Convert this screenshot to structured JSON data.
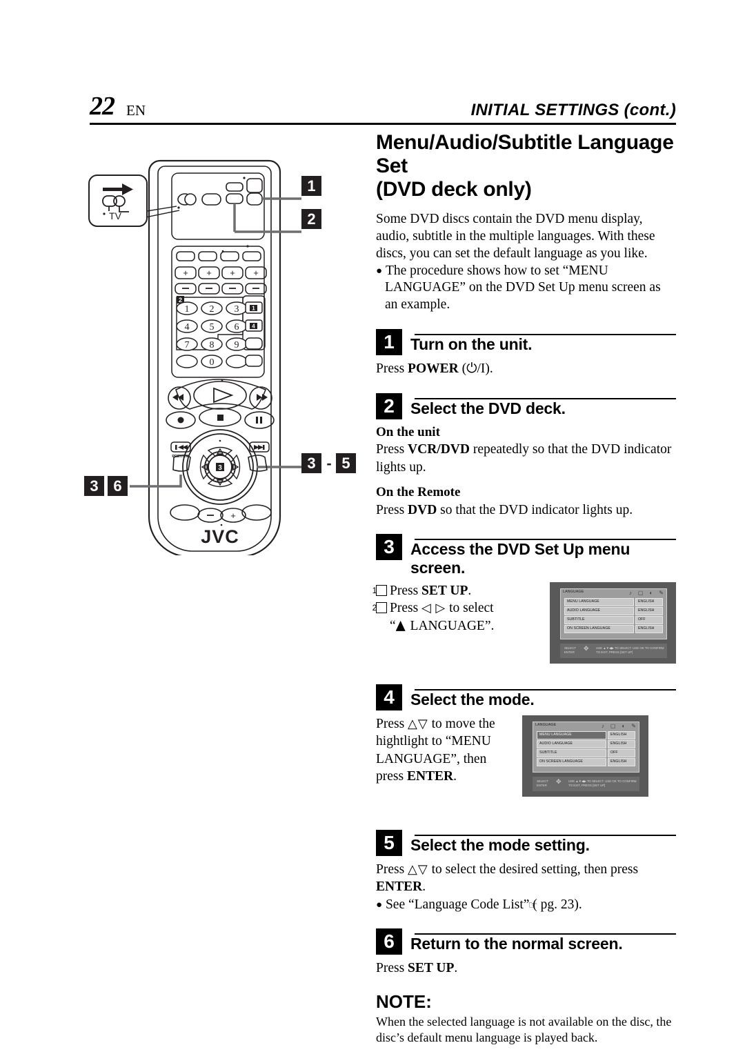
{
  "header": {
    "page_number": "22",
    "lang_code": "EN",
    "section_title": "INITIAL SETTINGS (cont.)"
  },
  "doc": {
    "title_line1": "Menu/Audio/Subtitle Language Set",
    "title_line2": "(DVD deck only)",
    "intro": "Some DVD discs contain the DVD menu display, audio, subtitle in the multiple languages. With these discs, you can set the default language as you like.",
    "intro_bullet_1": "The procedure shows how to set “MENU LANGUAGE” on the DVD Set Up menu screen as an example."
  },
  "steps": [
    {
      "num": "1",
      "title": "Turn on the unit.",
      "body_pre": "Press ",
      "body_bold": "POWER",
      "body_post": " (⏻/I)."
    },
    {
      "num": "2",
      "title": "Select the DVD deck.",
      "unit_heading": "On the unit",
      "unit_pre": "Press ",
      "unit_bold": "VCR/DVD",
      "unit_post": " repeatedly so that the DVD indicator lights up.",
      "remote_heading": "On the Remote",
      "remote_pre": "Press ",
      "remote_bold": "DVD",
      "remote_post": " so that the DVD indicator lights up."
    },
    {
      "num": "3",
      "title": "Access the DVD Set Up menu screen.",
      "item1_pre": "Press ",
      "item1_bold": "SET UP",
      "item1_post": ".",
      "item2_pre": "Press ",
      "item2_arrows": "◁ ▷",
      "item2_post": " to select",
      "item2_line2_quote": "“",
      "item2_line2_text": " LANGUAGE”."
    },
    {
      "num": "4",
      "title": "Select the mode.",
      "body_pre": "Press ",
      "body_arrows": "△▽",
      "body_mid": " to move the hightlight to “MENU LANGUAGE”, then press ",
      "body_bold": "ENTER",
      "body_post": "."
    },
    {
      "num": "5",
      "title": "Select the mode setting.",
      "body_pre": "Press ",
      "body_arrows": "△▽",
      "body_mid": " to select the desired setting, then press ",
      "body_bold": "ENTER",
      "body_post": ".",
      "bullet_pre": "See “Language Code List” (",
      "bullet_ref": " pg. 23).",
      "bullet_post": ""
    },
    {
      "num": "6",
      "title": "Return to the normal screen.",
      "body_pre": "Press ",
      "body_bold": "SET UP",
      "body_post": "."
    }
  ],
  "note": {
    "title": "NOTE:",
    "body": "When the selected language is not available on the disc, the disc’s default menu language is played back."
  },
  "osd": {
    "tab_name": "LANGUAGE",
    "tab_icons": [
      "audio-tab-icon",
      "screen-tab-icon",
      "disc-tab-icon",
      "tools-tab-icon"
    ],
    "rows": [
      {
        "label": "MENU LANGUAGE",
        "value": "ENGLISH"
      },
      {
        "label": "AUDIO LANGUAGE",
        "value": "ENGLISH"
      },
      {
        "label": "SUBTITLE",
        "value": "OFF"
      },
      {
        "label": "ON SCREEN LANGUAGE",
        "value": "ENGLISH"
      }
    ],
    "status_left_line1": "SELECT",
    "status_left_line2": "ENTER",
    "status_right_line1": "USE ▲▼◀▶ TO SELECT.  USE OK TO CONFIRM",
    "status_right_line2": "TO EXIT, PRESS [SET UP]",
    "selected_row_index_step3": -1,
    "selected_row_index_step4": 0
  },
  "remote": {
    "brand": "JVC",
    "tv_inset_label": "TV",
    "preview_label": "PREVIEW",
    "keypad": [
      "1",
      "2",
      "3",
      "4",
      "5",
      "6",
      "7",
      "8",
      "9",
      "0"
    ],
    "volume_plus": "+",
    "volume_minus": "−",
    "center_badge": "3",
    "keypad_badge_2": "2",
    "side_badge_1": "1",
    "side_badge_4": "4"
  },
  "callouts": {
    "one": "1",
    "two": "2",
    "three_a": "3",
    "dash": "-",
    "five": "5",
    "three_b": "3",
    "six": "6"
  }
}
